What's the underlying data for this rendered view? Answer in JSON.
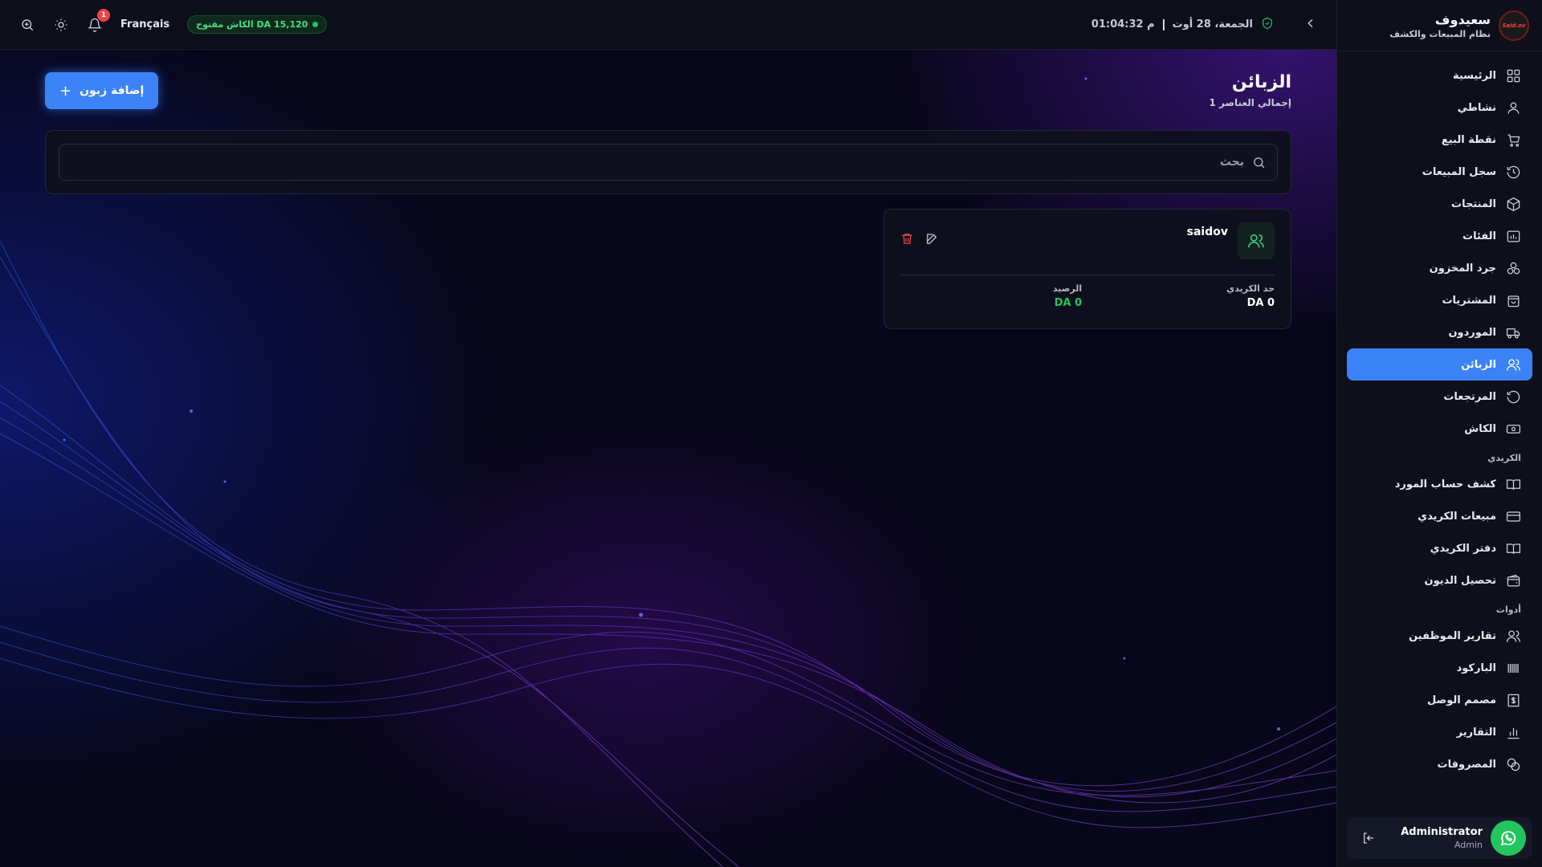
{
  "topbar": {
    "language": "Français",
    "cash_status": "الكاش مفتوح DA 15,120",
    "notification_count": "1",
    "datetime": "الجمعة، 28 أوت",
    "time": "01:04:32 م"
  },
  "brand": {
    "name": "سعيدوف",
    "subtitle": "نظام المبيعات والكشف",
    "logo_text": "Said.ov"
  },
  "sidebar": {
    "items": [
      {
        "label": "الرئيسية",
        "icon": "dashboard-icon"
      },
      {
        "label": "نشاطي",
        "icon": "user-icon"
      },
      {
        "label": "نقطة البيع",
        "icon": "cart-icon"
      },
      {
        "label": "سجل المبيعات",
        "icon": "history-icon"
      },
      {
        "label": "المنتجات",
        "icon": "box-icon"
      },
      {
        "label": "الفئات",
        "icon": "category-icon"
      },
      {
        "label": "جرد المخزون",
        "icon": "inventory-icon"
      },
      {
        "label": "المشتريات",
        "icon": "shopping-bag-icon"
      },
      {
        "label": "الموردون",
        "icon": "truck-icon"
      },
      {
        "label": "الزبائن",
        "icon": "users-icon",
        "active": true
      },
      {
        "label": "المرتجعات",
        "icon": "return-icon"
      },
      {
        "label": "الكاش",
        "icon": "cash-icon"
      }
    ],
    "section_credit": "الكريدي",
    "credit_items": [
      {
        "label": "كشف حساب المورد",
        "icon": "book-icon"
      },
      {
        "label": "مبيعات الكريدي",
        "icon": "credit-card-icon"
      },
      {
        "label": "دفتر الكريدي",
        "icon": "ledger-icon"
      },
      {
        "label": "تحصيل الديون",
        "icon": "wallet-icon"
      }
    ],
    "section_tools": "أدوات",
    "tool_items": [
      {
        "label": "تقارير الموظفين",
        "icon": "staff-icon"
      },
      {
        "label": "الباركود",
        "icon": "barcode-icon"
      },
      {
        "label": "مصمم الوصل",
        "icon": "receipt-icon"
      },
      {
        "label": "التقارير",
        "icon": "chart-icon"
      },
      {
        "label": "المصروفات",
        "icon": "expense-icon"
      }
    ],
    "user": {
      "name": "Administrator",
      "role": "Admin"
    }
  },
  "page": {
    "title": "الزبائن",
    "subtitle": "1 إجمالي العناصر",
    "add_button": "إضافة زبون",
    "search_placeholder": "بحث"
  },
  "customers": [
    {
      "name": "saidov",
      "credit_limit_label": "حد الكريدي",
      "credit_limit_value": "DA 0",
      "balance_label": "الرصيد",
      "balance_value": "DA 0"
    }
  ],
  "colors": {
    "accent": "#3b82f6",
    "success": "#22c55e",
    "danger": "#ef4444"
  }
}
